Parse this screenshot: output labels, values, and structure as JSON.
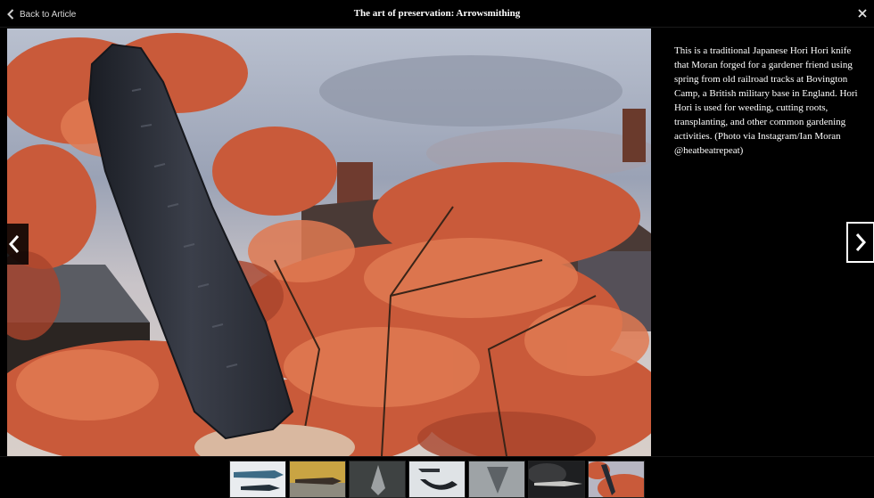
{
  "header": {
    "back_label": "Back to Article",
    "title": "The art of preservation: Arrowsmithing"
  },
  "caption": {
    "text": "This is a traditional Japanese Hori Hori knife that Moran forged for a gardener friend using spring from old railroad tracks at Bovington Camp, a British military base in England. Hori Hori is used for weeding, cutting roots, transplanting, and other common gardening activities. (Photo via Instagram/Ian Moran @heatbeatrepeat)"
  },
  "icons": {
    "back": "chevron-left-icon",
    "close": "close-icon",
    "prev": "chevron-left-icon",
    "next": "chevron-right-icon"
  },
  "colors": {
    "background": "#000000",
    "caption_text": "#ffffff",
    "accent_foliage": "#d9643f"
  },
  "thumbnails": [
    {
      "subject": "knives-on-white"
    },
    {
      "subject": "blade-on-yellow"
    },
    {
      "subject": "arrowhead-on-gray"
    },
    {
      "subject": "curved-blade-on-white"
    },
    {
      "subject": "point-on-gray"
    },
    {
      "subject": "spearhead-on-dark"
    },
    {
      "subject": "hori-hori-red-foliage"
    }
  ]
}
